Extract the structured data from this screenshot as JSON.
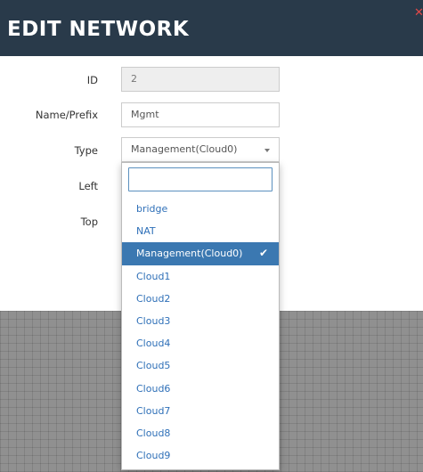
{
  "modal": {
    "title": "EDIT NETWORK",
    "close_icon": "close-icon",
    "colors": {
      "header_bg": "#293a4a",
      "close": "#e04848",
      "selected_bg": "#3b78b1",
      "option_text": "#2f70b8"
    }
  },
  "form": {
    "id": {
      "label": "ID",
      "value": "2"
    },
    "name": {
      "label": "Name/Prefix",
      "value": "Mgmt"
    },
    "type": {
      "label": "Type",
      "value": "Management(Cloud0)"
    },
    "left": {
      "label": "Left"
    },
    "top": {
      "label": "Top"
    }
  },
  "dropdown": {
    "search_value": "",
    "options": [
      {
        "label": "bridge",
        "selected": false
      },
      {
        "label": "NAT",
        "selected": false
      },
      {
        "label": "Management(Cloud0)",
        "selected": true,
        "icon": "check-icon"
      },
      {
        "label": "Cloud1",
        "selected": false
      },
      {
        "label": "Cloud2",
        "selected": false
      },
      {
        "label": "Cloud3",
        "selected": false
      },
      {
        "label": "Cloud4",
        "selected": false
      },
      {
        "label": "Cloud5",
        "selected": false
      },
      {
        "label": "Cloud6",
        "selected": false
      },
      {
        "label": "Cloud7",
        "selected": false
      },
      {
        "label": "Cloud8",
        "selected": false
      },
      {
        "label": "Cloud9",
        "selected": false
      }
    ]
  }
}
